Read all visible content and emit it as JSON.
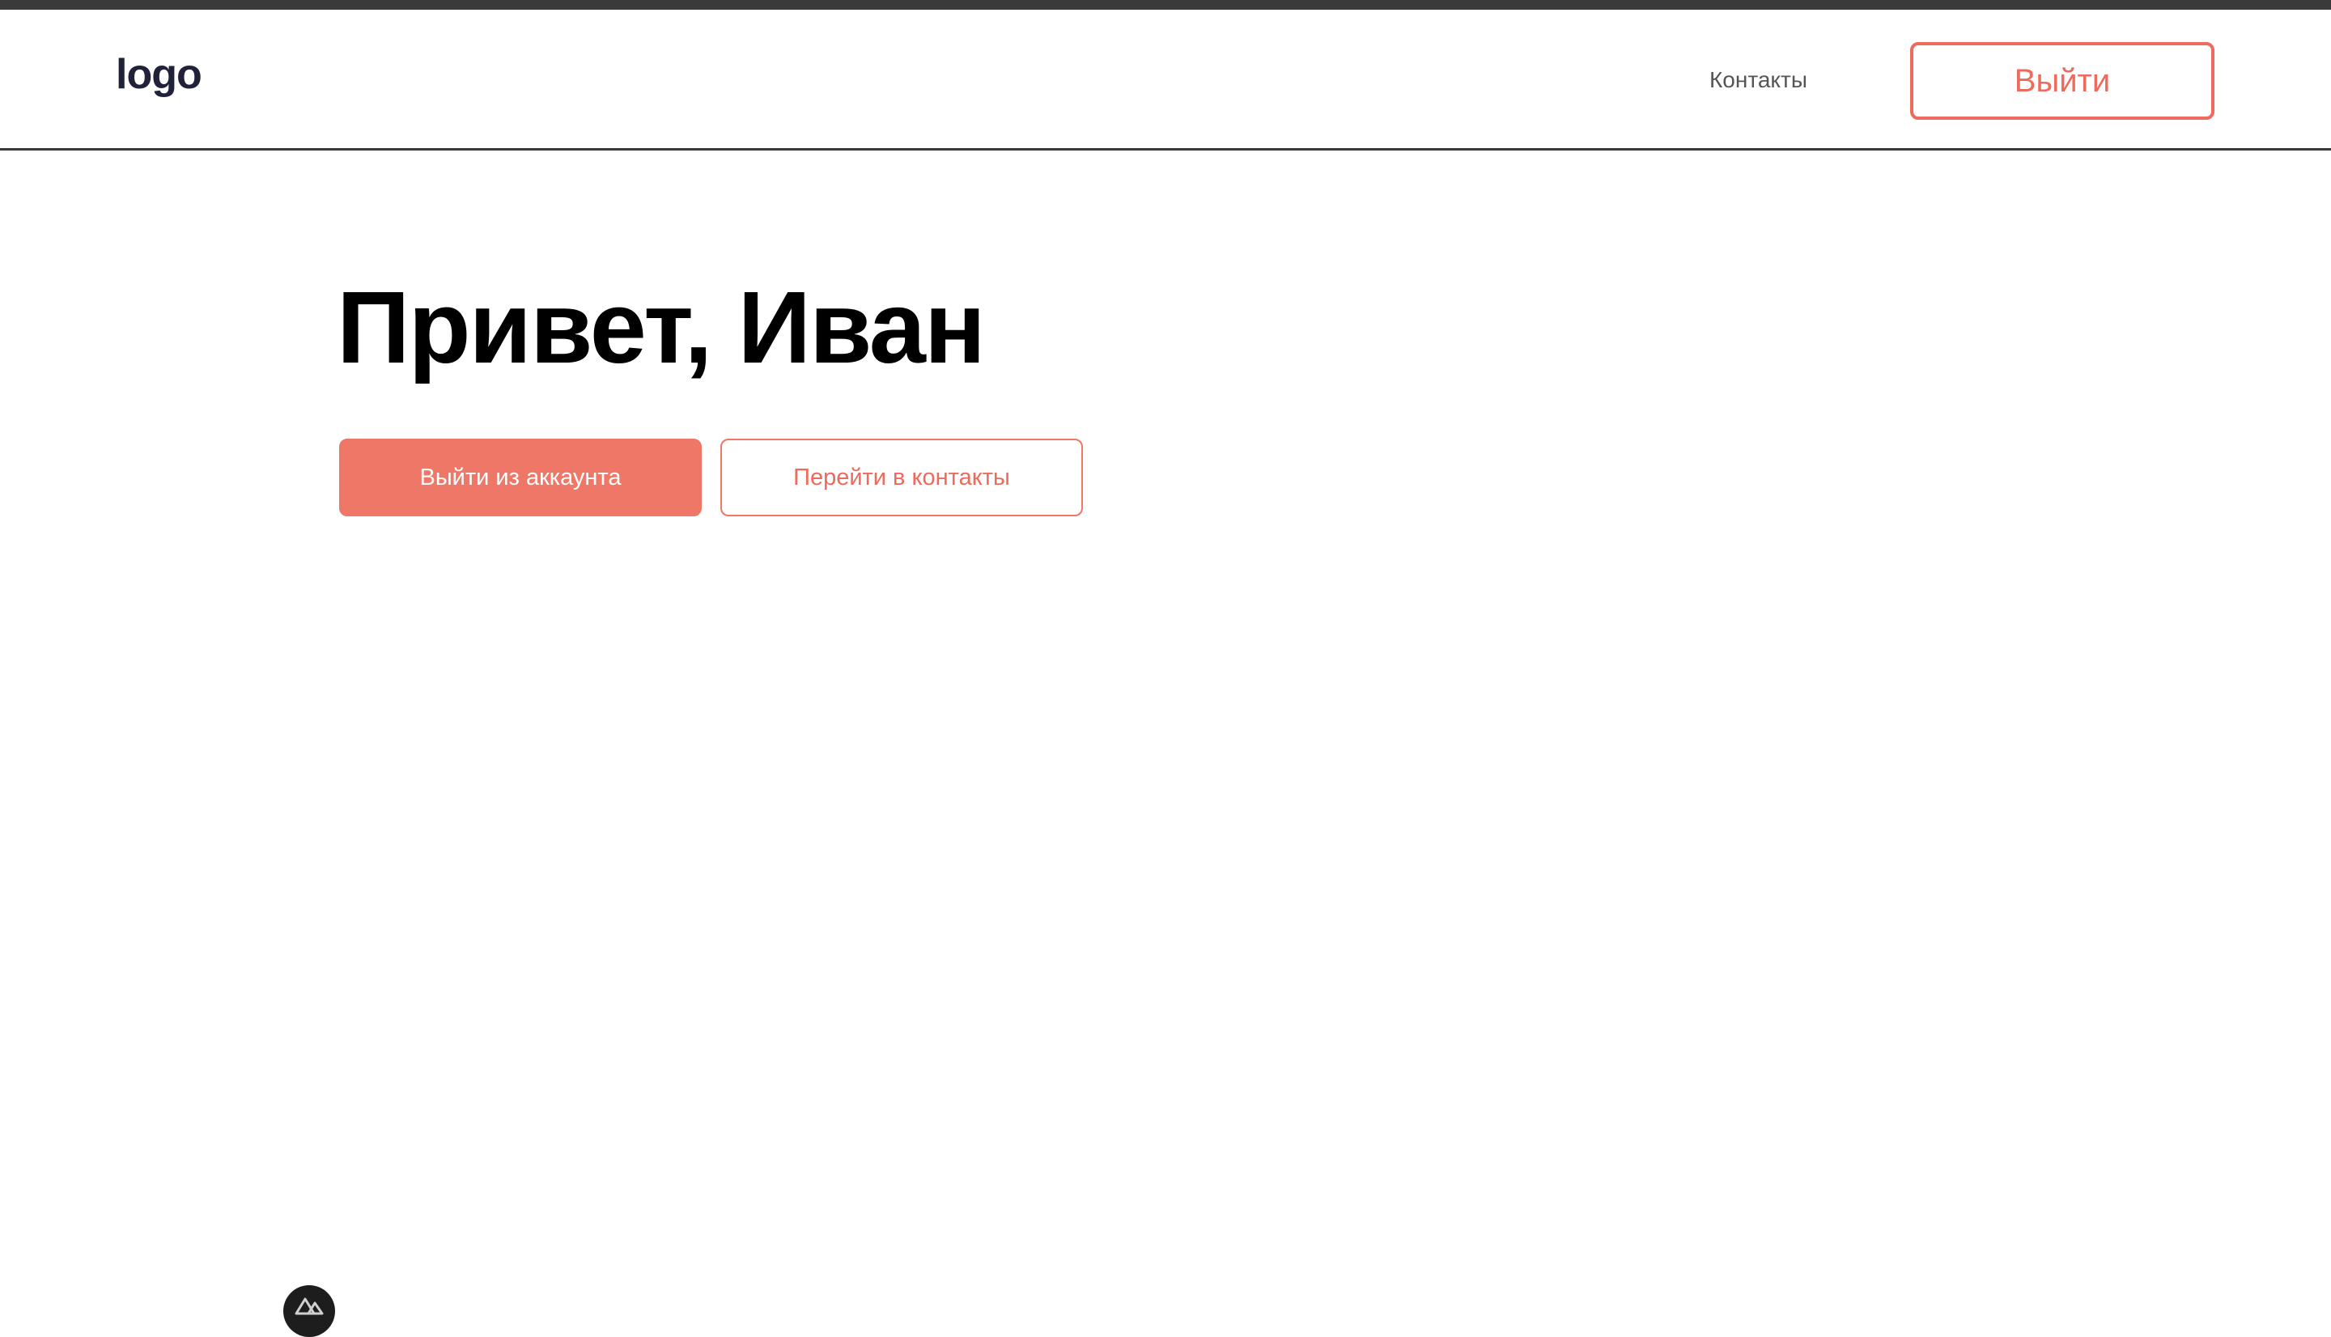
{
  "header": {
    "logo": "logo",
    "nav_contacts": "Контакты",
    "logout_label": "Выйти"
  },
  "main": {
    "greeting": "Привет, Иван",
    "logout_account_label": "Выйти из аккаунта",
    "go_to_contacts_label": "Перейти в контакты"
  },
  "devtools": {
    "icon": "nuxt-logo-icon"
  },
  "colors": {
    "accent": "#ee7767",
    "accent_text": "#ee6a5c",
    "header_border": "#3a3a3a",
    "logo": "#1f2238"
  }
}
